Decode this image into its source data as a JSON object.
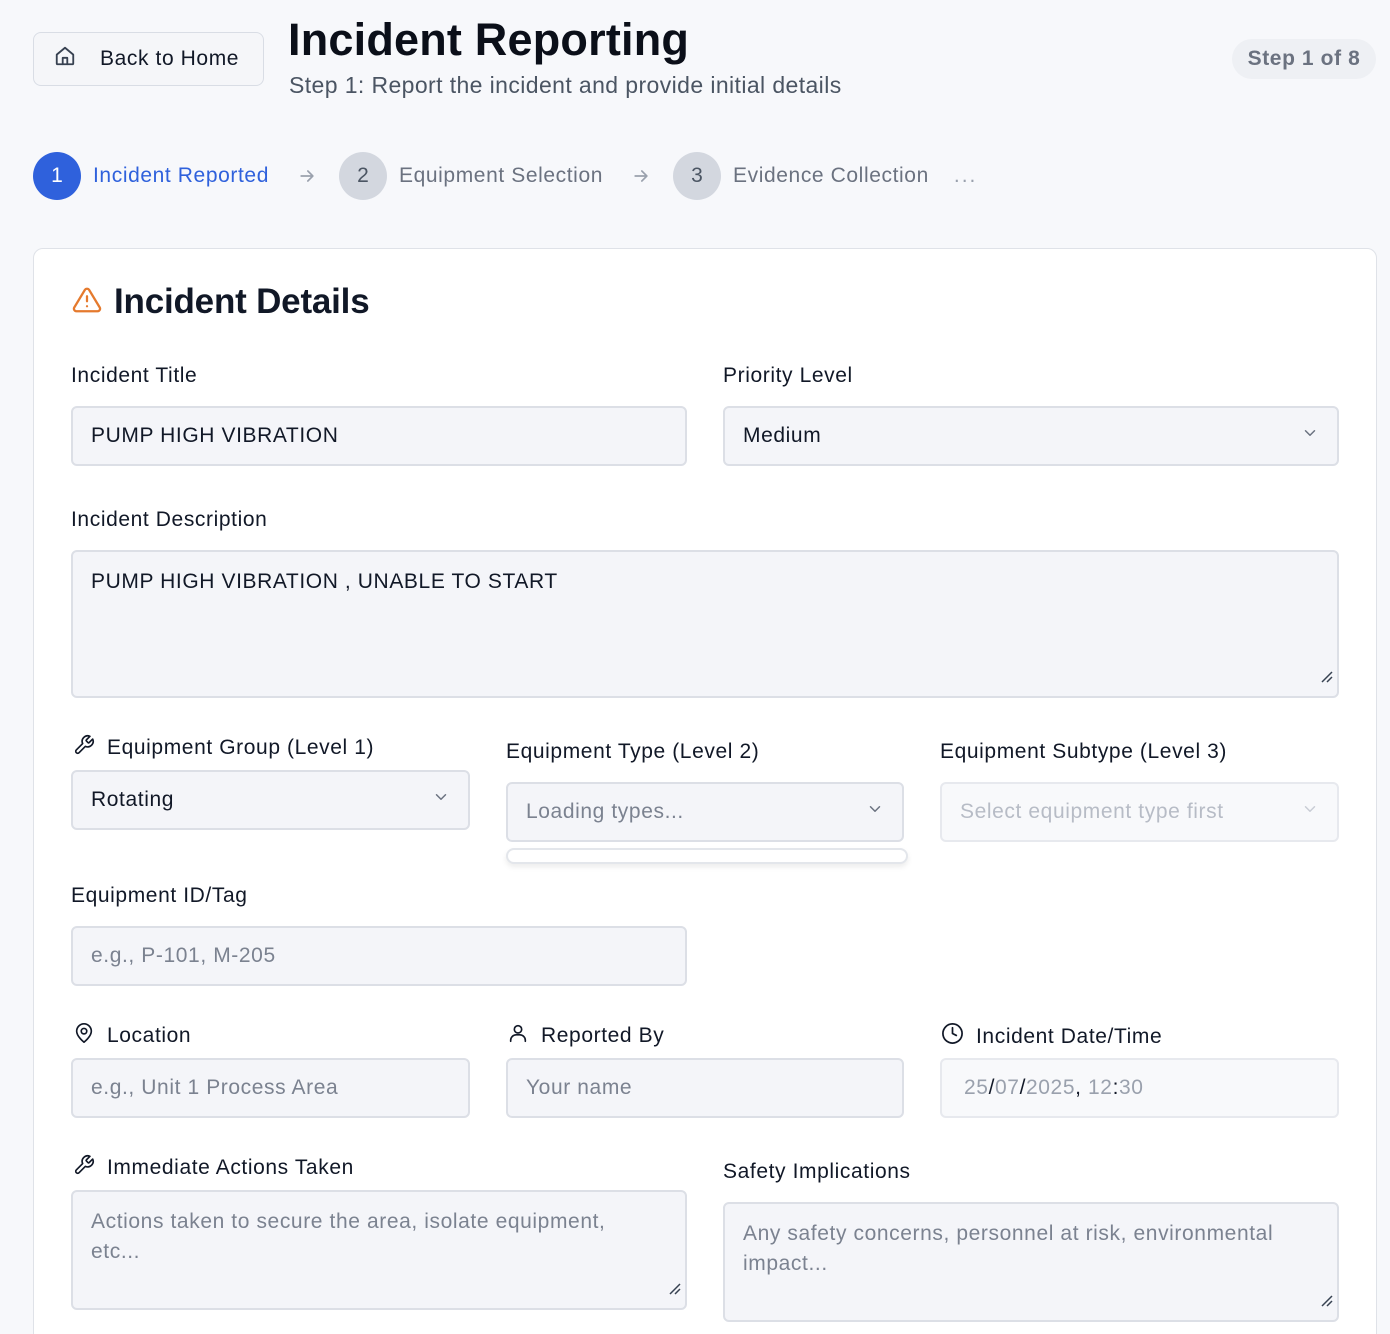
{
  "header": {
    "back_label": "Back to Home",
    "title": "Incident Reporting",
    "subtitle": "Step 1: Report the incident and provide initial details",
    "step_badge": "Step 1 of 8"
  },
  "stepper": {
    "steps": [
      {
        "number": "1",
        "label": "Incident Reported",
        "state": "active"
      },
      {
        "number": "2",
        "label": "Equipment Selection",
        "state": "pending"
      },
      {
        "number": "3",
        "label": "Evidence Collection",
        "state": "pending"
      }
    ],
    "more": "..."
  },
  "card": {
    "title": "Incident Details",
    "title_icon": "warning-triangle-icon",
    "accent_color": "#e57a2e"
  },
  "form": {
    "incident_title": {
      "label": "Incident Title",
      "value": "PUMP HIGH VIBRATION"
    },
    "priority": {
      "label": "Priority Level",
      "value": "Medium"
    },
    "description": {
      "label": "Incident Description",
      "value": "PUMP HIGH VIBRATION , UNABLE TO START"
    },
    "equipment_group": {
      "label": "Equipment Group (Level 1)",
      "value": "Rotating",
      "icon": "wrench-icon"
    },
    "equipment_type": {
      "label": "Equipment Type (Level 2)",
      "value": "Loading types..."
    },
    "equipment_subtype": {
      "label": "Equipment Subtype (Level 3)",
      "value": "Select equipment type first"
    },
    "equipment_id": {
      "label": "Equipment ID/Tag",
      "placeholder": "e.g., P-101, M-205"
    },
    "location": {
      "label": "Location",
      "placeholder": "e.g., Unit 1 Process Area",
      "icon": "map-pin-icon"
    },
    "reported_by": {
      "label": "Reported By",
      "placeholder": "Your name",
      "icon": "user-icon"
    },
    "datetime": {
      "label": "Incident Date/Time",
      "day": "25",
      "month": "07",
      "year": "2025",
      "hour": "12",
      "minute": "30",
      "icon": "clock-icon"
    },
    "immediate_actions": {
      "label": "Immediate Actions Taken",
      "placeholder": "Actions taken to secure the area, isolate equipment, etc...",
      "icon": "wrench-icon"
    },
    "safety": {
      "label": "Safety Implications",
      "placeholder": "Any safety concerns, personnel at risk, environmental impact..."
    }
  },
  "colors": {
    "primary": "#2f61dc",
    "background": "#f7f8fb",
    "field_bg": "#f4f5f9"
  }
}
